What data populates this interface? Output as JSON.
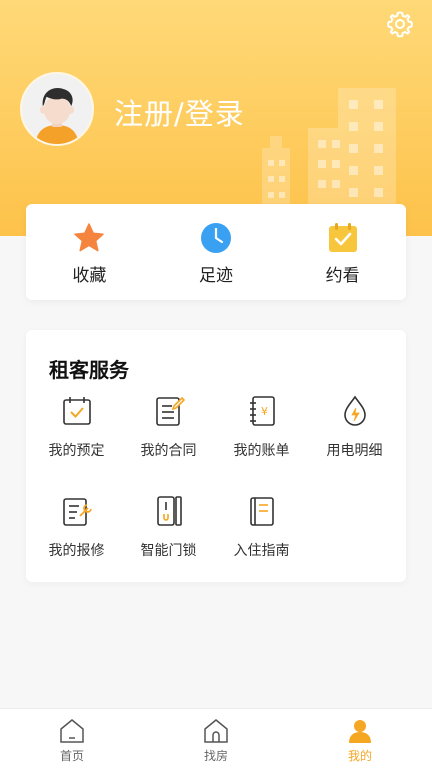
{
  "header": {
    "login_label": "注册/登录",
    "settings_icon": "gear-icon",
    "gradient_top": "#ffd978",
    "gradient_bottom": "#fdc24a"
  },
  "quick_actions": [
    {
      "label": "收藏",
      "icon": "star-icon",
      "color": "#f5843f"
    },
    {
      "label": "足迹",
      "icon": "clock-icon",
      "color": "#3aa0f2"
    },
    {
      "label": "约看",
      "icon": "calendar-check-icon",
      "color": "#f7c63d"
    }
  ],
  "services": {
    "title": "租客服务",
    "items": [
      {
        "label": "我的预定",
        "icon": "calendar-check-icon"
      },
      {
        "label": "我的合同",
        "icon": "contract-edit-icon"
      },
      {
        "label": "我的账单",
        "icon": "bill-notebook-icon"
      },
      {
        "label": "用电明细",
        "icon": "electricity-drop-icon"
      },
      {
        "label": "我的报修",
        "icon": "repair-document-icon"
      },
      {
        "label": "智能门锁",
        "icon": "smart-lock-icon"
      },
      {
        "label": "入住指南",
        "icon": "guide-book-icon"
      }
    ]
  },
  "tabbar": {
    "items": [
      {
        "label": "首页",
        "icon": "home-icon",
        "active": false
      },
      {
        "label": "找房",
        "icon": "house-search-icon",
        "active": false
      },
      {
        "label": "我的",
        "icon": "user-icon",
        "active": true
      }
    ],
    "active_color": "#f5a623"
  }
}
